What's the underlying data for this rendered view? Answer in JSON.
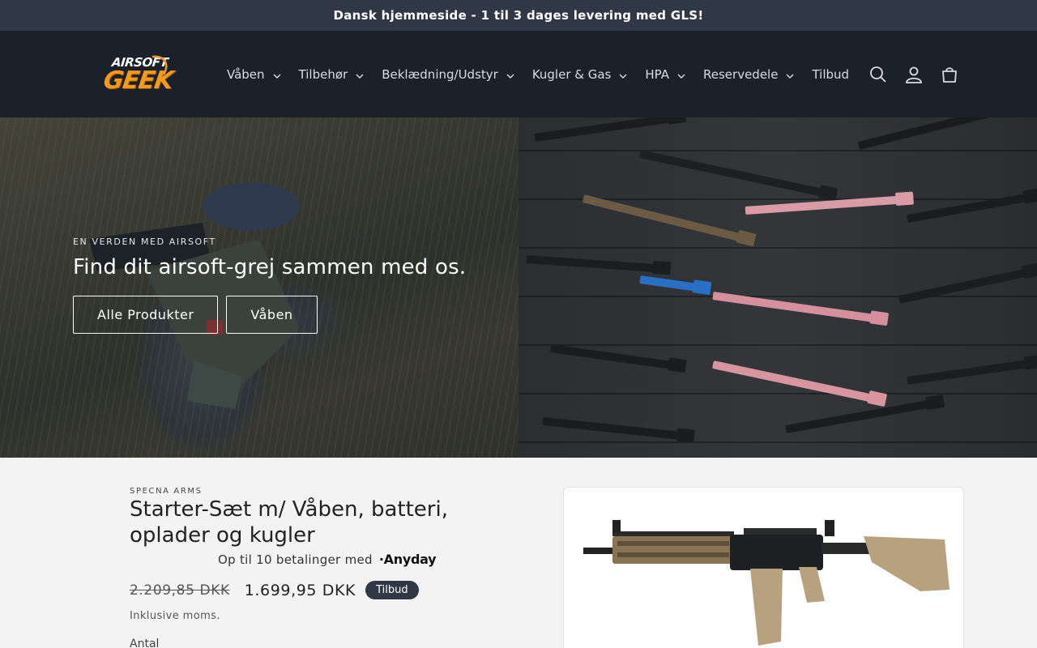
{
  "announcement": "Dansk hjemmeside - 1 til 3 dages levering med GLS!",
  "logo": {
    "line1": "AIRSOFT",
    "line2": "GEEK"
  },
  "nav": [
    {
      "label": "Våben",
      "dropdown": true
    },
    {
      "label": "Tilbehør",
      "dropdown": true
    },
    {
      "label": "Beklædning/Udstyr",
      "dropdown": true
    },
    {
      "label": "Kugler & Gas",
      "dropdown": true
    },
    {
      "label": "HPA",
      "dropdown": true
    },
    {
      "label": "Reservedele",
      "dropdown": true
    },
    {
      "label": "Tilbud",
      "dropdown": false
    }
  ],
  "header_icons": [
    "search-icon",
    "account-icon",
    "cart-icon"
  ],
  "hero": {
    "eyebrow": "EN VERDEN MED AIRSOFT",
    "title": "Find dit airsoft-grej sammen med os.",
    "buttons": [
      "Alle Produkter",
      "Våben"
    ]
  },
  "product": {
    "vendor": "SPECNA ARMS",
    "title": "Starter-Sæt m/ Våben, batteri, oplader og kugler",
    "installments_text": "Op til 10 betalinger med",
    "installments_brand": "Anyday",
    "old_price": "2.209,85 DKK",
    "price": "1.699,95 DKK",
    "badge": "Tilbud",
    "tax_note": "Inklusive moms.",
    "quantity_label": "Antal"
  },
  "colors": {
    "announcement_bg": "#313845",
    "header_bg": "#1b212b",
    "page_bg": "#f3f3f3",
    "badge_bg": "#313845",
    "logo_orange": "#f39a1d"
  }
}
